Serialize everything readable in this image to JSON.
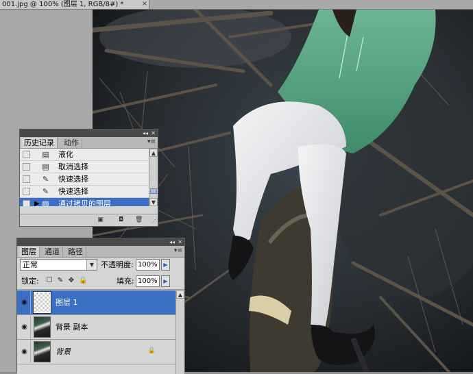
{
  "document": {
    "tab_title": "001.jpg @ 100% (图层 1, RGB/8#) *",
    "close_glyph": "×"
  },
  "history_panel": {
    "tabs": [
      "历史记录",
      "动作"
    ],
    "items": [
      {
        "label": "液化",
        "icon": "history-state-icon"
      },
      {
        "label": "取消选择",
        "icon": "history-state-icon"
      },
      {
        "label": "快速选择",
        "icon": "quick-selection-icon"
      },
      {
        "label": "快速选择",
        "icon": "quick-selection-icon"
      },
      {
        "label": "通过拷贝的图层",
        "icon": "history-state-icon",
        "selected": true
      }
    ],
    "selected_color": "#3a6fc4"
  },
  "layers_panel": {
    "tabs": [
      "图层",
      "通道",
      "路径"
    ],
    "blend_mode": "正常",
    "opacity_label": "不透明度:",
    "opacity_value": "100%",
    "lock_label": "锁定:",
    "fill_label": "填充:",
    "fill_value": "100%",
    "layers": [
      {
        "name": "图层 1",
        "selected": true,
        "thumb": "transparent"
      },
      {
        "name": "背景 副本",
        "selected": false,
        "thumb": "image"
      },
      {
        "name": "背景",
        "selected": false,
        "thumb": "image",
        "locked": true
      }
    ]
  }
}
